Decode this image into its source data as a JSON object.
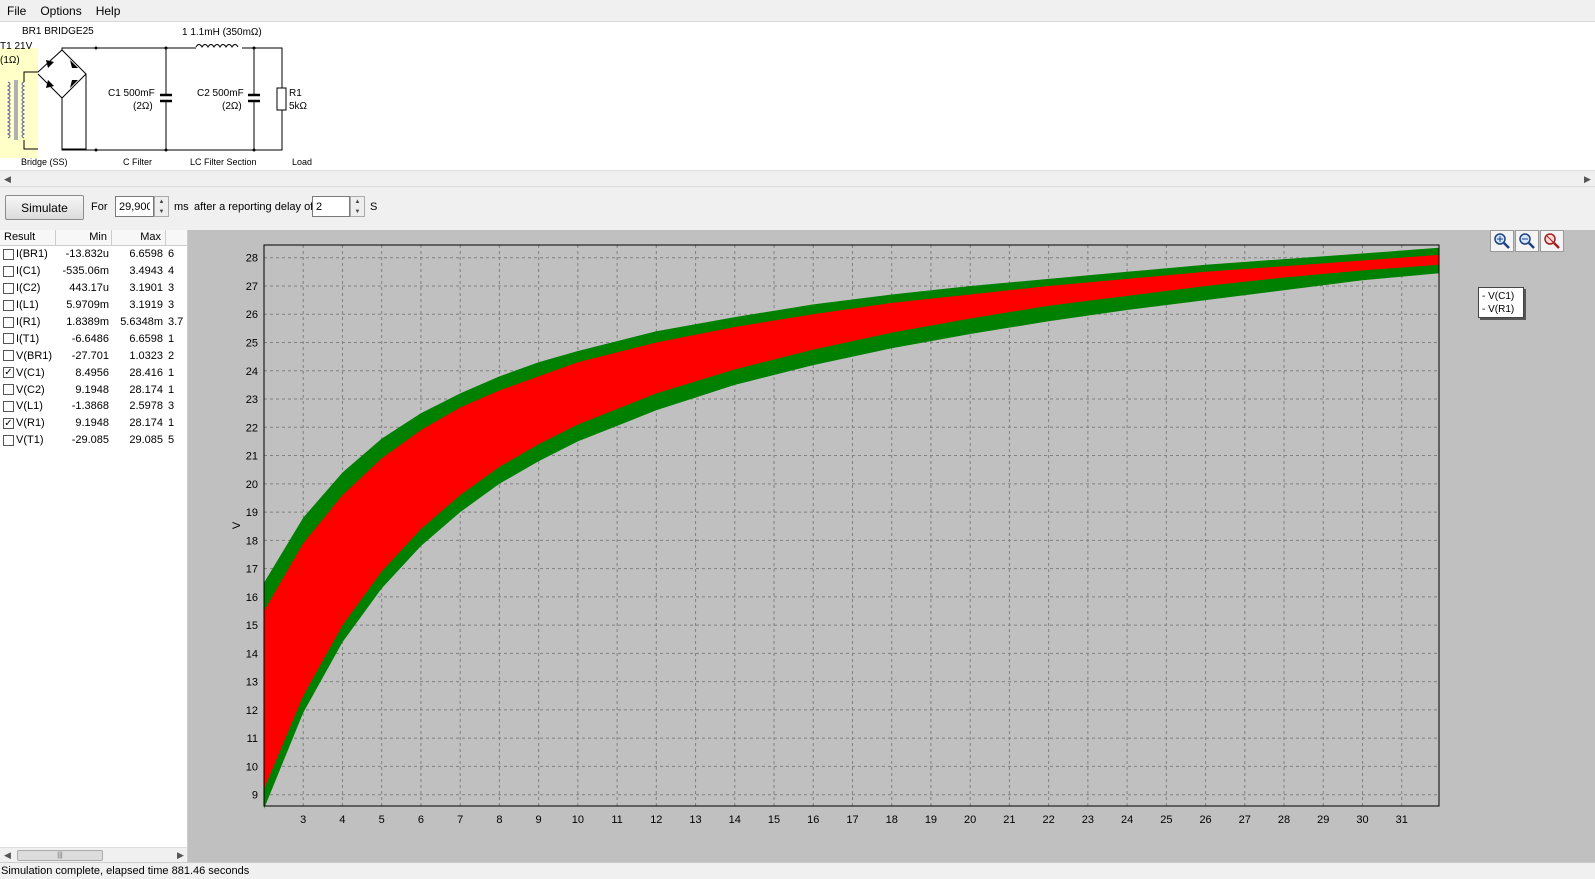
{
  "menu": [
    "File",
    "Options",
    "Help"
  ],
  "schematic": {
    "transformer": [
      "T1 21V",
      "(1Ω)"
    ],
    "bridge": "BR1 BRIDGE25",
    "inductor": "1 1.1mH (350mΩ)",
    "c1": [
      "C1 500mF",
      "(2Ω)"
    ],
    "c2": [
      "C2 500mF",
      "(2Ω)"
    ],
    "r1": [
      "R1",
      "5kΩ"
    ],
    "sections": [
      "Bridge (SS)",
      "C Filter",
      "LC Filter Section",
      "Load"
    ]
  },
  "toolbar": {
    "simulate_label": "Simulate",
    "for_label": "For",
    "duration_value": "29,900",
    "ms_label": "ms",
    "delay_label": "after a reporting delay of",
    "delay_value": "2",
    "s_label": "S"
  },
  "results": {
    "headers": [
      "Result",
      "Min",
      "Max"
    ],
    "rows": [
      {
        "name": "I(BR1)",
        "min": "-13.832u",
        "max": "6.6598",
        "extra": "6",
        "checked": false
      },
      {
        "name": "I(C1)",
        "min": "-535.06m",
        "max": "3.4943",
        "extra": "4",
        "checked": false
      },
      {
        "name": "I(C2)",
        "min": "443.17u",
        "max": "3.1901",
        "extra": "3",
        "checked": false
      },
      {
        "name": "I(L1)",
        "min": "5.9709m",
        "max": "3.1919",
        "extra": "3",
        "checked": false
      },
      {
        "name": "I(R1)",
        "min": "1.8389m",
        "max": "5.6348m",
        "extra": "3.7",
        "checked": false
      },
      {
        "name": "I(T1)",
        "min": "-6.6486",
        "max": "6.6598",
        "extra": "1",
        "checked": false
      },
      {
        "name": "V(BR1)",
        "min": "-27.701",
        "max": "1.0323",
        "extra": "2",
        "checked": false
      },
      {
        "name": "V(C1)",
        "min": "8.4956",
        "max": "28.416",
        "extra": "1",
        "checked": true
      },
      {
        "name": "V(C2)",
        "min": "9.1948",
        "max": "28.174",
        "extra": "1",
        "checked": false
      },
      {
        "name": "V(L1)",
        "min": "-1.3868",
        "max": "2.5978",
        "extra": "3",
        "checked": false
      },
      {
        "name": "V(R1)",
        "min": "9.1948",
        "max": "28.174",
        "extra": "1",
        "checked": true
      },
      {
        "name": "V(T1)",
        "min": "-29.085",
        "max": "29.085",
        "extra": "5",
        "checked": false
      }
    ]
  },
  "legend": [
    "V(C1)",
    "V(R1)"
  ],
  "status": "Simulation complete, elapsed time 881.46 seconds",
  "colors": {
    "v_c1": "#008000",
    "v_r1": "#ff0000",
    "plot_bg": "#c0c0c0"
  },
  "chart_data": {
    "type": "area",
    "ylabel": "V",
    "xlim": [
      2,
      31.95
    ],
    "ylim": [
      8.6,
      28.45
    ],
    "xticks": [
      3,
      4,
      5,
      6,
      7,
      8,
      9,
      10,
      11,
      12,
      13,
      14,
      15,
      16,
      17,
      18,
      19,
      20,
      21,
      22,
      23,
      24,
      25,
      26,
      27,
      28,
      29,
      30,
      31
    ],
    "yticks": [
      9,
      10,
      11,
      12,
      13,
      14,
      15,
      16,
      17,
      18,
      19,
      20,
      21,
      22,
      23,
      24,
      25,
      26,
      27,
      28
    ],
    "grid": true,
    "legend_position": "top-right",
    "series": [
      {
        "name": "V(C1)",
        "x": [
          2,
          3,
          4,
          5,
          6,
          7,
          8,
          9,
          10,
          12,
          14,
          16,
          18,
          20,
          22,
          24,
          26,
          28,
          30,
          31.95
        ],
        "upper": [
          16.5,
          18.8,
          20.4,
          21.6,
          22.5,
          23.2,
          23.8,
          24.3,
          24.7,
          25.4,
          25.9,
          26.35,
          26.7,
          27.0,
          27.25,
          27.5,
          27.75,
          27.95,
          28.15,
          28.35
        ],
        "lower": [
          8.5,
          11.9,
          14.4,
          16.3,
          17.8,
          19.0,
          20.0,
          20.8,
          21.5,
          22.6,
          23.5,
          24.2,
          24.8,
          25.3,
          25.75,
          26.15,
          26.5,
          26.85,
          27.2,
          27.45
        ]
      },
      {
        "name": "V(R1)",
        "x": [
          2,
          3,
          4,
          5,
          6,
          7,
          8,
          9,
          10,
          12,
          14,
          16,
          18,
          20,
          22,
          24,
          26,
          28,
          30,
          31.95
        ],
        "upper": [
          15.5,
          17.9,
          19.6,
          20.9,
          21.9,
          22.7,
          23.3,
          23.8,
          24.3,
          25.0,
          25.55,
          26.0,
          26.4,
          26.7,
          27.0,
          27.25,
          27.5,
          27.7,
          27.9,
          28.1
        ],
        "lower": [
          9.2,
          12.5,
          15.0,
          16.9,
          18.4,
          19.6,
          20.6,
          21.4,
          22.1,
          23.2,
          24.05,
          24.75,
          25.35,
          25.85,
          26.3,
          26.65,
          27.0,
          27.3,
          27.55,
          27.75
        ]
      }
    ]
  }
}
